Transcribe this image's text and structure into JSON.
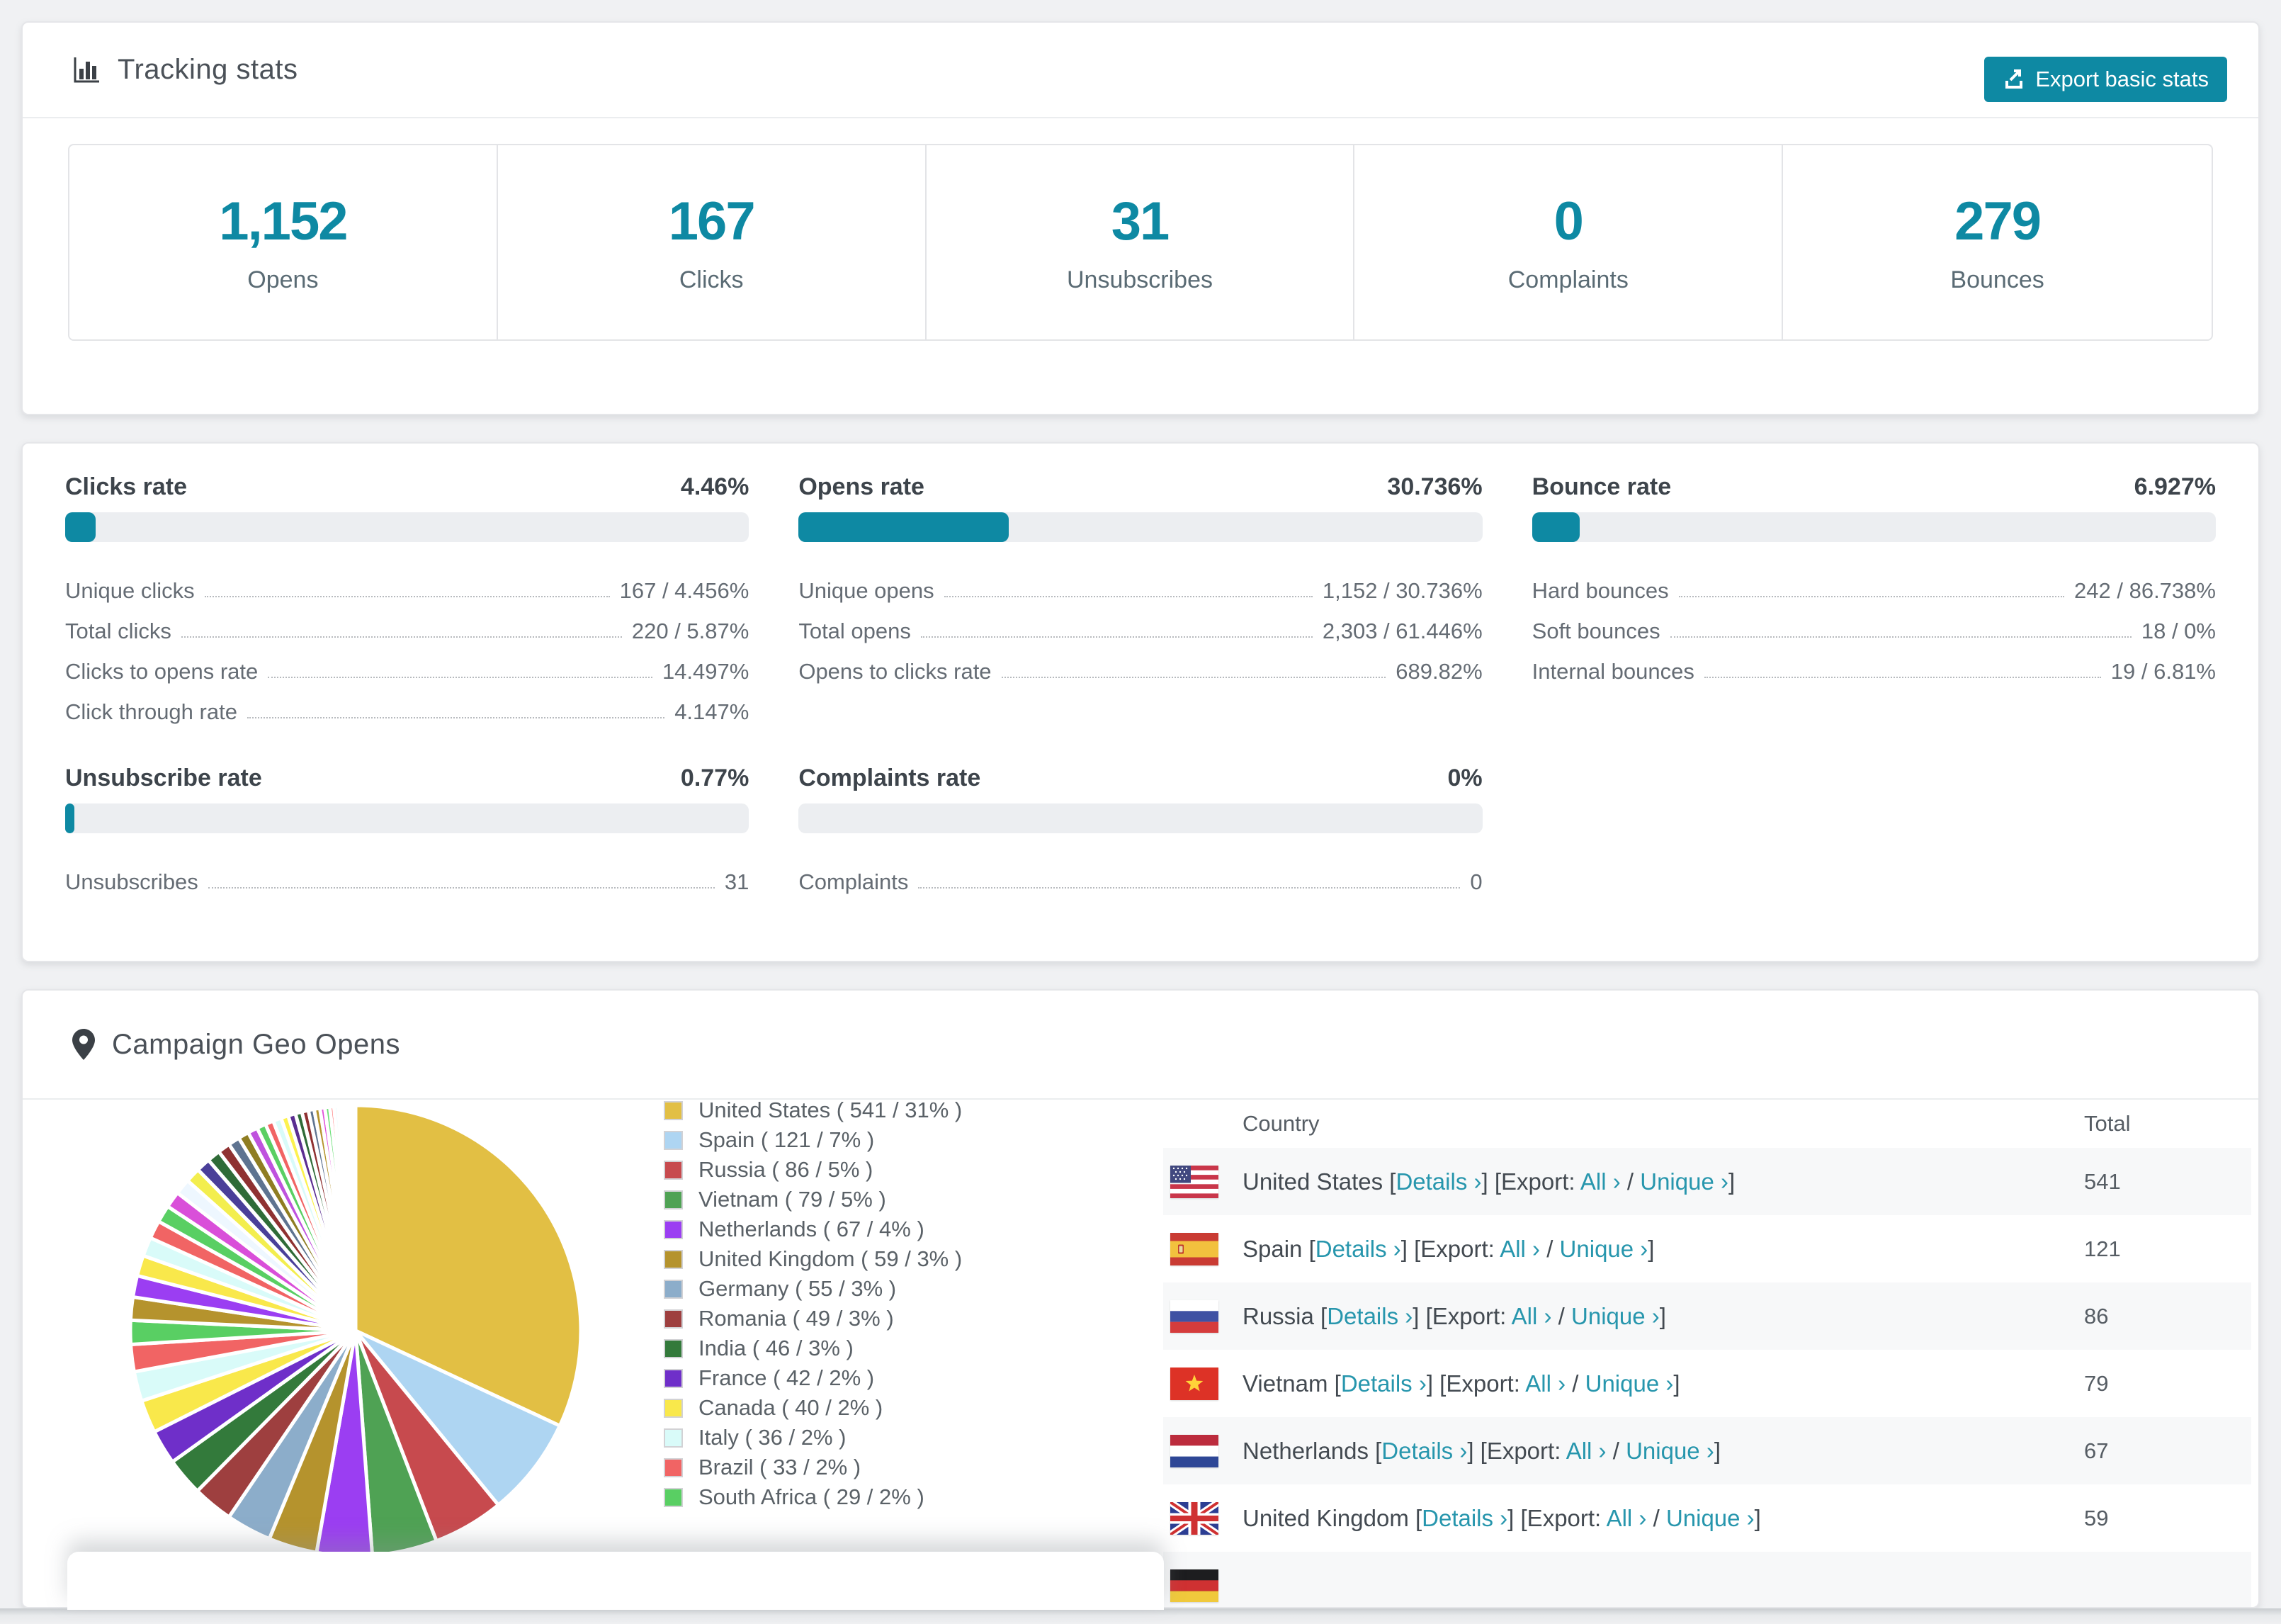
{
  "accent": "#0e89a3",
  "link_color": "#2796ad",
  "tracking": {
    "title": "Tracking stats",
    "export_button": "Export basic stats",
    "stats": [
      {
        "value": "1,152",
        "label": "Opens"
      },
      {
        "value": "167",
        "label": "Clicks"
      },
      {
        "value": "31",
        "label": "Unsubscribes"
      },
      {
        "value": "0",
        "label": "Complaints"
      },
      {
        "value": "279",
        "label": "Bounces"
      }
    ]
  },
  "rates": [
    {
      "title": "Clicks rate",
      "percent": "4.46%",
      "fill_pct": 4.46,
      "rows": [
        {
          "label": "Unique clicks",
          "value": "167 / 4.456%"
        },
        {
          "label": "Total clicks",
          "value": "220 / 5.87%"
        },
        {
          "label": "Clicks to opens rate",
          "value": "14.497%"
        },
        {
          "label": "Click through rate",
          "value": "4.147%"
        }
      ]
    },
    {
      "title": "Opens rate",
      "percent": "30.736%",
      "fill_pct": 30.736,
      "rows": [
        {
          "label": "Unique opens",
          "value": "1,152 / 30.736%"
        },
        {
          "label": "Total opens",
          "value": "2,303 / 61.446%"
        },
        {
          "label": "Opens to clicks rate",
          "value": "689.82%"
        }
      ]
    },
    {
      "title": "Bounce rate",
      "percent": "6.927%",
      "fill_pct": 6.927,
      "rows": [
        {
          "label": "Hard bounces",
          "value": "242 / 86.738%"
        },
        {
          "label": "Soft bounces",
          "value": "18 / 0%"
        },
        {
          "label": "Internal bounces",
          "value": "19 / 6.81%"
        }
      ]
    },
    {
      "title": "Unsubscribe rate",
      "percent": "0.77%",
      "fill_pct": 0.77,
      "rows": [
        {
          "label": "Unsubscribes",
          "value": "31"
        }
      ]
    },
    {
      "title": "Complaints rate",
      "percent": "0%",
      "fill_pct": 0,
      "rows": [
        {
          "label": "Complaints",
          "value": "0"
        }
      ]
    }
  ],
  "geo": {
    "title": "Campaign Geo Opens",
    "table": {
      "columns": [
        "Country",
        "Total"
      ],
      "details_label": "Details ›",
      "export_prefix": "Export:",
      "all_label": "All ›",
      "unique_label": "Unique ›",
      "rows": [
        {
          "flag": "us",
          "country": "United States",
          "total": "541"
        },
        {
          "flag": "es",
          "country": "Spain",
          "total": "121"
        },
        {
          "flag": "ru",
          "country": "Russia",
          "total": "86"
        },
        {
          "flag": "vn",
          "country": "Vietnam",
          "total": "79"
        },
        {
          "flag": "nl",
          "country": "Netherlands",
          "total": "67"
        },
        {
          "flag": "gb",
          "country": "United Kingdom",
          "total": "59"
        },
        {
          "flag": "de",
          "country": "",
          "total": ""
        }
      ]
    }
  },
  "chart_data": {
    "type": "pie",
    "title": "Campaign Geo Opens",
    "legend_position": "right",
    "start_angle_deg": 0,
    "series": [
      {
        "name": "United States",
        "value": 541,
        "pct": "31%",
        "color": "#e2bf44",
        "label": "United States ( 541 / 31% )"
      },
      {
        "name": "Spain",
        "value": 121,
        "pct": "7%",
        "color": "#aed5f2",
        "label": "Spain ( 121 / 7% )"
      },
      {
        "name": "Russia",
        "value": 86,
        "pct": "5%",
        "color": "#c74a4e",
        "label": "Russia ( 86 / 5% )"
      },
      {
        "name": "Vietnam",
        "value": 79,
        "pct": "5%",
        "color": "#4fa254",
        "label": "Vietnam ( 79 / 5% )"
      },
      {
        "name": "Netherlands",
        "value": 67,
        "pct": "4%",
        "color": "#9b3ef2",
        "label": "Netherlands ( 67 / 4% )"
      },
      {
        "name": "United Kingdom",
        "value": 59,
        "pct": "3%",
        "color": "#b5932d",
        "label": "United Kingdom ( 59 / 3% )"
      },
      {
        "name": "Germany",
        "value": 55,
        "pct": "3%",
        "color": "#8cadca",
        "label": "Germany ( 55 / 3% )"
      },
      {
        "name": "Romania",
        "value": 49,
        "pct": "3%",
        "color": "#9e3f3f",
        "label": "Romania ( 49 / 3% )"
      },
      {
        "name": "India",
        "value": 46,
        "pct": "3%",
        "color": "#337a3b",
        "label": "India ( 46 / 3% )"
      },
      {
        "name": "France",
        "value": 42,
        "pct": "2%",
        "color": "#6f2fc9",
        "label": "France ( 42 / 2% )"
      },
      {
        "name": "Canada",
        "value": 40,
        "pct": "2%",
        "color": "#f9e84b",
        "label": "Canada ( 40 / 2% )"
      },
      {
        "name": "Italy",
        "value": 36,
        "pct": "2%",
        "color": "#d9fbf9",
        "label": "Italy ( 36 / 2% )"
      },
      {
        "name": "Brazil",
        "value": 33,
        "pct": "2%",
        "color": "#f16464",
        "label": "Brazil ( 33 / 2% )"
      },
      {
        "name": "South Africa",
        "value": 29,
        "pct": "2%",
        "color": "#59cf63",
        "label": "South Africa ( 29 / 2% )"
      }
    ],
    "other_slices": {
      "values": [
        28,
        26,
        25,
        23,
        22,
        21,
        20,
        19,
        18,
        17,
        16,
        15,
        14,
        13,
        12,
        11,
        10,
        10,
        9,
        9,
        8,
        8,
        7,
        7,
        6,
        6,
        5,
        5,
        4,
        4,
        3,
        3,
        2,
        2,
        2,
        1
      ],
      "colors": [
        "#b5932d",
        "#9b3ef2",
        "#f9e84b",
        "#d9fbf9",
        "#f16464",
        "#59cf63",
        "#d94fd9",
        "#eef7ff",
        "#f3ee4e",
        "#4a3f99",
        "#2f6b38",
        "#8f3131",
        "#5e7390",
        "#8f7d22",
        "#bf52de",
        "#59cf63",
        "#f16464",
        "#d9fbf9",
        "#fdf24f",
        "#5b2d91",
        "#2f6b38",
        "#8f3131",
        "#5e7390",
        "#b5932d",
        "#e052d9",
        "#6fe07a",
        "#ff7070",
        "#eafcff",
        "#f9e84b",
        "#3b2f8f",
        "#1f5c2f",
        "#7a2727",
        "#4d6380",
        "#9c8822",
        "#c45fe8",
        "#77e884"
      ]
    }
  }
}
